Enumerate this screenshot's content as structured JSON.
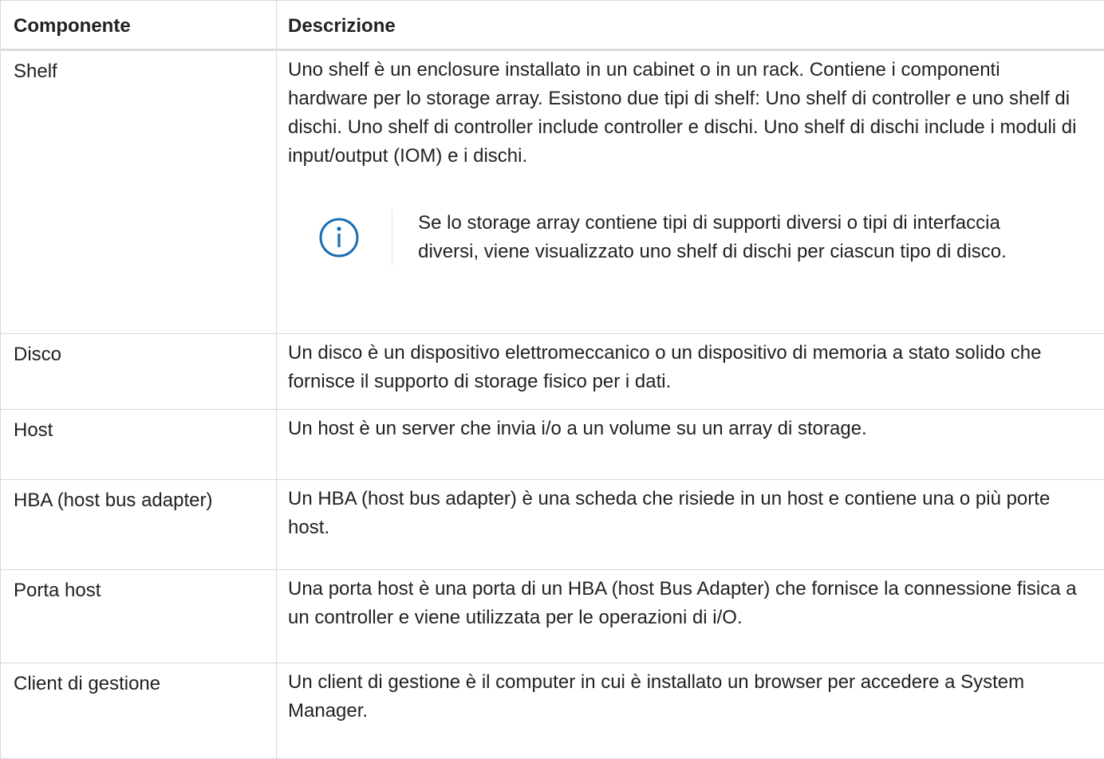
{
  "table": {
    "headers": [
      "Componente",
      "Descrizione"
    ],
    "rows": [
      {
        "name": "Shelf",
        "description": "Uno shelf è un enclosure installato in un cabinet o in un rack. Contiene i componenti hardware per lo storage array. Esistono due tipi di shelf: Uno shelf di controller e uno shelf di dischi. Uno shelf di controller include controller e dischi. Uno shelf di dischi include i moduli di input/output (IOM) e i dischi.",
        "note": {
          "icon": "info-icon",
          "text": "Se lo storage array contiene tipi di supporti diversi o tipi di interfaccia diversi, viene visualizzato uno shelf di dischi per ciascun tipo di disco."
        }
      },
      {
        "name": "Disco",
        "description": "Un disco è un dispositivo elettromeccanico o un dispositivo di memoria a stato solido che fornisce il supporto di storage fisico per i dati."
      },
      {
        "name": "Host",
        "description": "Un host è un server che invia i/o a un volume su un array di storage."
      },
      {
        "name": "HBA (host bus adapter)",
        "description": "Un HBA (host bus adapter) è una scheda che risiede in un host e contiene una o più porte host."
      },
      {
        "name": "Porta host",
        "description": "Una porta host è una porta di un HBA (host Bus Adapter) che fornisce la connessione fisica a un controller e viene utilizzata per le operazioni di i/O."
      },
      {
        "name": "Client di gestione",
        "description": "Un client di gestione è il computer in cui è installato un browser per accedere a System Manager."
      }
    ]
  },
  "colors": {
    "info_icon": "#1a6fb5",
    "border": "#d8d8d8",
    "text": "#222222"
  }
}
